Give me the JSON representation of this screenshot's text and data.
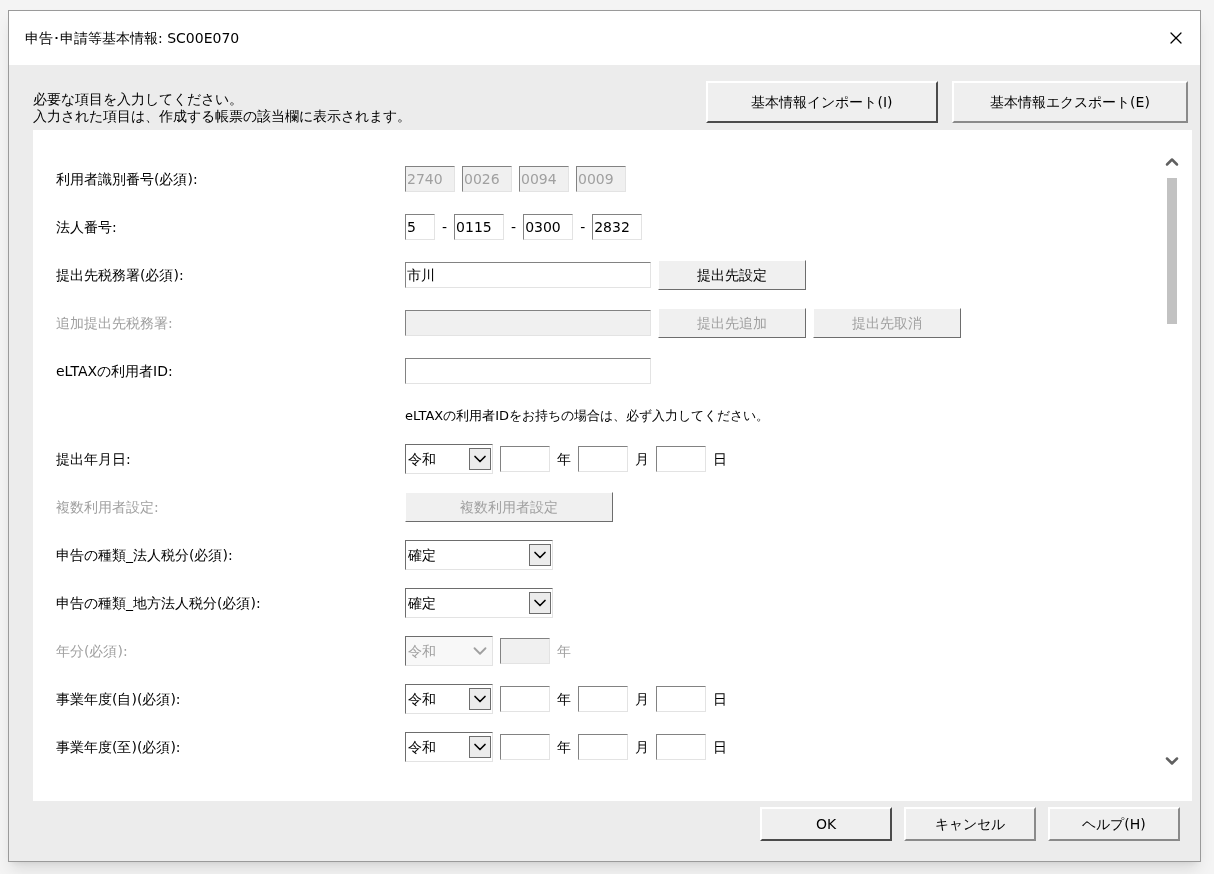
{
  "window": {
    "title": "申告･申請等基本情報: SC00E070"
  },
  "instructions": [
    "必要な項目を入力してください。",
    "入力された項目は、作成する帳票の該当欄に表示されます。"
  ],
  "header_buttons": [
    "基本情報インポート(I)",
    "基本情報エクスポート(E)"
  ],
  "rows": [
    {
      "kind": "field",
      "label": "利用者識別番号(必須):",
      "disabled": false,
      "controls": [
        {
          "kind": "box",
          "value": "2740",
          "disabled": true
        },
        {
          "kind": "box",
          "value": "0026",
          "disabled": true
        },
        {
          "kind": "box",
          "value": "0094",
          "disabled": true
        },
        {
          "kind": "box",
          "value": "0009",
          "disabled": true
        }
      ]
    },
    {
      "kind": "field",
      "label": "法人番号:",
      "disabled": false,
      "controls": [
        {
          "kind": "digit",
          "value": "5",
          "disabled": false
        },
        {
          "kind": "sep",
          "text": "-",
          "disabled": false
        },
        {
          "kind": "box",
          "value": "0115",
          "disabled": false
        },
        {
          "kind": "sep",
          "text": "-",
          "disabled": false
        },
        {
          "kind": "box",
          "value": "0300",
          "disabled": false
        },
        {
          "kind": "sep",
          "text": "-",
          "disabled": false
        },
        {
          "kind": "box",
          "value": "2832",
          "disabled": false
        }
      ]
    },
    {
      "kind": "field",
      "label": "提出先税務署(必須):",
      "disabled": false,
      "controls": [
        {
          "kind": "long",
          "value": "市川",
          "disabled": false
        },
        {
          "kind": "button",
          "label": "提出先設定",
          "disabled": false
        }
      ]
    },
    {
      "kind": "field",
      "label": "追加提出先税務署:",
      "disabled": true,
      "controls": [
        {
          "kind": "long",
          "disabled": true
        },
        {
          "kind": "button",
          "label": "提出先追加",
          "disabled": true
        },
        {
          "kind": "button",
          "label": "提出先取消",
          "disabled": true
        }
      ]
    },
    {
      "kind": "field",
      "label": "eLTAXの利用者ID:",
      "disabled": false,
      "controls": [
        {
          "kind": "long",
          "disabled": false
        }
      ]
    },
    {
      "kind": "note",
      "text": "eLTAXの利用者IDをお持ちの場合は、必ず入力してください。"
    },
    {
      "kind": "field",
      "label": "提出年月日:",
      "disabled": false,
      "controls": [
        {
          "kind": "era",
          "value": "令和",
          "disabled": false
        },
        {
          "kind": "box",
          "disabled": false
        },
        {
          "kind": "sep",
          "text": "年",
          "disabled": false
        },
        {
          "kind": "box",
          "disabled": false
        },
        {
          "kind": "sep",
          "text": "月",
          "disabled": false
        },
        {
          "kind": "box",
          "disabled": false
        },
        {
          "kind": "sep",
          "text": "日",
          "disabled": false
        }
      ]
    },
    {
      "kind": "field",
      "label": "複数利用者設定:",
      "disabled": true,
      "controls": [
        {
          "kind": "widebutton",
          "label": "複数利用者設定",
          "disabled": true
        }
      ]
    },
    {
      "kind": "field",
      "label": "申告の種類_法人税分(必須):",
      "disabled": false,
      "controls": [
        {
          "kind": "combo",
          "value": "確定",
          "disabled": false
        }
      ]
    },
    {
      "kind": "field",
      "label": "申告の種類_地方法人税分(必須):",
      "disabled": false,
      "controls": [
        {
          "kind": "combo",
          "value": "確定",
          "disabled": false
        }
      ]
    },
    {
      "kind": "field",
      "label": "年分(必須):",
      "disabled": true,
      "controls": [
        {
          "kind": "era",
          "value": "令和",
          "disabled": true
        },
        {
          "kind": "box",
          "disabled": true
        },
        {
          "kind": "sep",
          "text": "年",
          "disabled": true
        }
      ]
    },
    {
      "kind": "field",
      "label": "事業年度(自)(必須):",
      "disabled": false,
      "controls": [
        {
          "kind": "era",
          "value": "令和",
          "disabled": false
        },
        {
          "kind": "box",
          "disabled": false
        },
        {
          "kind": "sep",
          "text": "年",
          "disabled": false
        },
        {
          "kind": "box",
          "disabled": false
        },
        {
          "kind": "sep",
          "text": "月",
          "disabled": false
        },
        {
          "kind": "box",
          "disabled": false
        },
        {
          "kind": "sep",
          "text": "日",
          "disabled": false
        }
      ]
    },
    {
      "kind": "field",
      "label": "事業年度(至)(必須):",
      "disabled": false,
      "controls": [
        {
          "kind": "era",
          "value": "令和",
          "disabled": false
        },
        {
          "kind": "box",
          "disabled": false
        },
        {
          "kind": "sep",
          "text": "年",
          "disabled": false
        },
        {
          "kind": "box",
          "disabled": false
        },
        {
          "kind": "sep",
          "text": "月",
          "disabled": false
        },
        {
          "kind": "box",
          "disabled": false
        },
        {
          "kind": "sep",
          "text": "日",
          "disabled": false
        }
      ]
    }
  ],
  "footer_buttons": [
    "OK",
    "キャンセル",
    "ヘルプ(H)"
  ]
}
